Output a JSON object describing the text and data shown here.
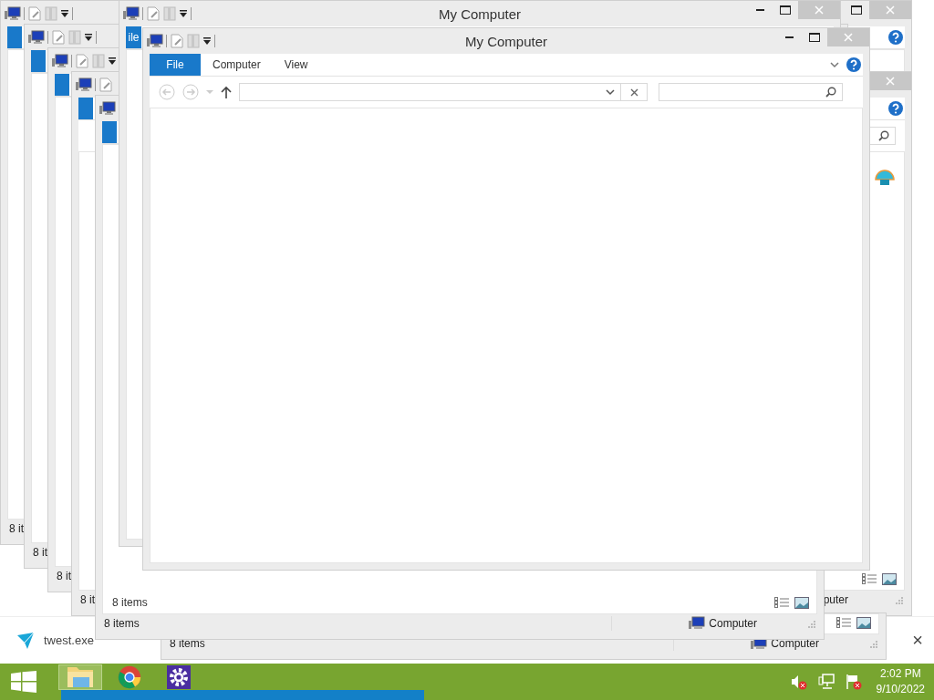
{
  "windows": [
    {
      "titlebar": true,
      "controls": [
        {
          "kind": "maximize"
        },
        {
          "kind": "close"
        }
      ],
      "tabs": [
        {
          "selected": true
        }
      ],
      "help": true,
      "status": {
        "left": "8 it"
      }
    },
    {
      "titlebar": true,
      "title": "My Computer",
      "controls": [
        {
          "kind": "minimize"
        },
        {
          "kind": "maximize"
        },
        {
          "kind": "close"
        }
      ],
      "tabs": [
        {
          "label": "ile",
          "selected": true
        }
      ]
    },
    {
      "titlebar": true,
      "tabs": [
        {
          "selected": true
        }
      ],
      "status": {
        "left": "8 it"
      }
    },
    {
      "titlebar": true,
      "title": "My Computer",
      "controls": [
        {
          "kind": "minimize"
        },
        {
          "kind": "maximize"
        },
        {
          "kind": "close"
        }
      ],
      "tabs": [
        {
          "label": "File",
          "selected": true
        },
        {
          "label": "Computer",
          "selected": false
        },
        {
          "label": "View",
          "selected": false
        }
      ],
      "collapse": true,
      "help": true,
      "nav": {
        "kind": "full"
      }
    },
    {
      "titlebar": true,
      "tabs": [
        {
          "selected": true
        }
      ],
      "status": {
        "left": "8 it"
      }
    },
    {
      "titlebar": true,
      "controls": [
        {
          "kind": "close"
        }
      ],
      "tabs": [
        {
          "selected": true
        }
      ],
      "help": true,
      "nav": {
        "kind": "search"
      },
      "app_icon": true,
      "view_icons": true,
      "status": {
        "left": "8 it",
        "right": "puter"
      }
    },
    {
      "titlebar": true,
      "tabs": [
        {
          "selected": true
        }
      ],
      "footer_text": "8 items",
      "view_icons": true,
      "status": {
        "left": "8 items",
        "right": "Computer",
        "location_icon": true
      }
    },
    {
      "view_icons": true,
      "status": {
        "left": "8 items",
        "right": "Computer",
        "location_icon": true
      }
    }
  ],
  "notification": {
    "text": "twest.exe",
    "close": "×"
  },
  "taskbar": {
    "items": [
      {
        "kind": "explorer",
        "active": true
      },
      {
        "kind": "chrome",
        "active": false
      },
      {
        "kind": "settings",
        "active": false
      }
    ],
    "tray": [
      {
        "kind": "volume"
      },
      {
        "kind": "network"
      },
      {
        "kind": "flag"
      }
    ],
    "time": "2:02 PM",
    "date": "9/10/2022"
  }
}
